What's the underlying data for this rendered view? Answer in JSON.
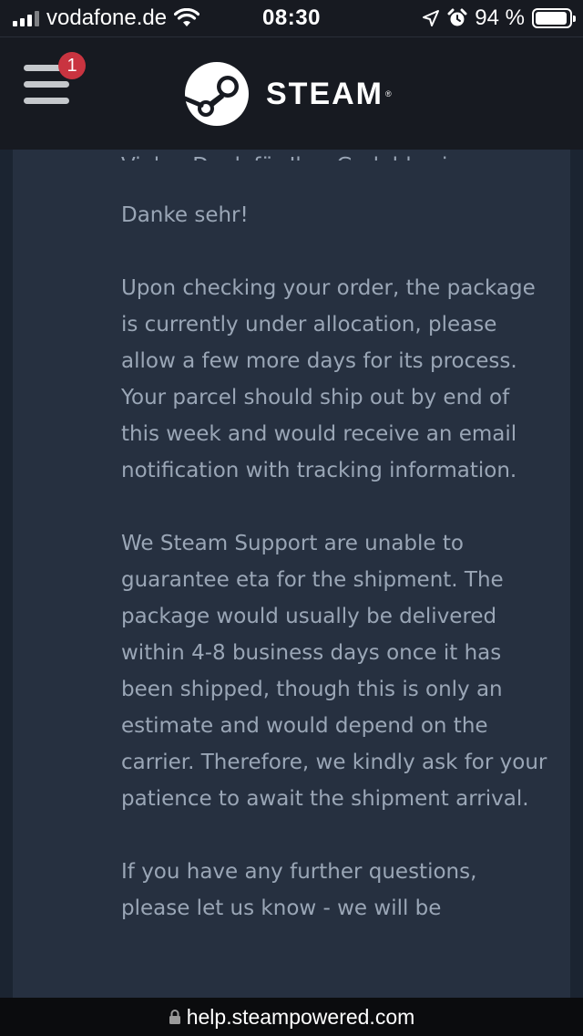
{
  "status_bar": {
    "carrier": "vodafone.de",
    "time": "08:30",
    "battery_percent": "94 %",
    "battery_level": 0.94
  },
  "header": {
    "menu_badge_count": "1",
    "brand": "STEAM",
    "brand_mark": "®"
  },
  "message": {
    "truncated_top_line": "Vielen Dank für Ihre Geduld, wir",
    "closing": "Danke sehr!",
    "paragraphs": [
      "Upon checking your order, the package is currently under allocation, please allow a few more days for its process. Your parcel should ship out by end of this week and would receive an email notification with tracking information.",
      "We Steam Support are unable to guarantee eta for the shipment. The package would usually be delivered within 4-8 business days once it has been shipped, though this is only an estimate and would depend on the carrier. Therefore, we kindly ask for your patience to await the shipment arrival.",
      "If you have any further questions, please let us know - we will be"
    ]
  },
  "url_bar": {
    "url": "help.steampowered.com"
  },
  "colors": {
    "header_bg": "#171a21",
    "page_bg": "#1b2431",
    "panel_bg": "#263040",
    "text": "#9aa6b6",
    "badge": "#c93440"
  },
  "icons": {
    "signal": "cellular-signal-icon",
    "wifi": "wifi-icon",
    "location": "location-arrow-icon",
    "alarm": "alarm-clock-icon",
    "battery": "battery-icon",
    "menu": "hamburger-menu-icon",
    "logo": "steam-logo-icon",
    "lock": "lock-icon"
  }
}
